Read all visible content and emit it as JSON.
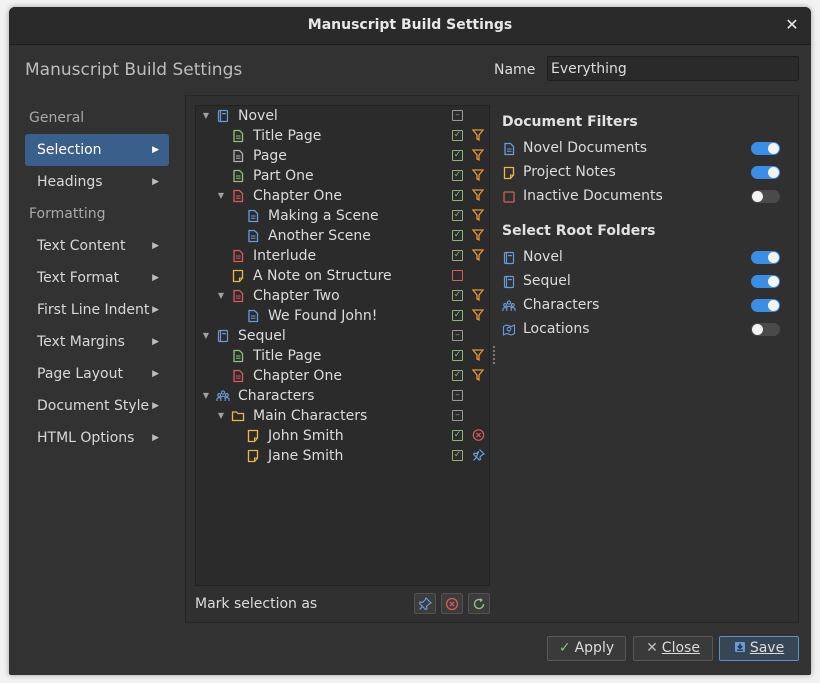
{
  "window": {
    "title": "Manuscript Build Settings"
  },
  "header": {
    "heading": "Manuscript Build Settings",
    "name_label": "Name",
    "name_value": "Everything"
  },
  "nav": {
    "items": [
      {
        "type": "section",
        "label": "General"
      },
      {
        "type": "item",
        "label": "Selection",
        "active": true
      },
      {
        "type": "item",
        "label": "Headings"
      },
      {
        "type": "section",
        "label": "Formatting"
      },
      {
        "type": "item",
        "label": "Text Content"
      },
      {
        "type": "item",
        "label": "Text Format"
      },
      {
        "type": "item",
        "label": "First Line Indent"
      },
      {
        "type": "item",
        "label": "Text Margins"
      },
      {
        "type": "item",
        "label": "Page Layout"
      },
      {
        "type": "item",
        "label": "Document Style"
      },
      {
        "type": "item",
        "label": "HTML Options"
      }
    ]
  },
  "tree": {
    "rows": [
      {
        "label": "Novel",
        "depth": 0,
        "expander": true,
        "icon": "book-icon",
        "check": "mixed",
        "filter": "none"
      },
      {
        "label": "Title Page",
        "depth": 1,
        "expander": false,
        "icon": "doc-green-icon",
        "check": "on",
        "filter": "filter"
      },
      {
        "label": "Page",
        "depth": 1,
        "expander": false,
        "icon": "doc-gray-icon",
        "check": "on",
        "filter": "filter"
      },
      {
        "label": "Part One",
        "depth": 1,
        "expander": false,
        "icon": "doc-green-icon",
        "check": "on",
        "filter": "filter"
      },
      {
        "label": "Chapter One",
        "depth": 1,
        "expander": true,
        "icon": "doc-red-icon",
        "check": "on",
        "filter": "filter"
      },
      {
        "label": "Making a Scene",
        "depth": 2,
        "expander": false,
        "icon": "doc-blue-icon",
        "check": "on",
        "filter": "filter"
      },
      {
        "label": "Another Scene",
        "depth": 2,
        "expander": false,
        "icon": "doc-blue-icon",
        "check": "on",
        "filter": "filter"
      },
      {
        "label": "Interlude",
        "depth": 1,
        "expander": false,
        "icon": "doc-red-icon",
        "check": "on",
        "filter": "filter"
      },
      {
        "label": "A Note on Structure",
        "depth": 1,
        "expander": false,
        "icon": "note-icon",
        "check": "off",
        "filter": "none"
      },
      {
        "label": "Chapter Two",
        "depth": 1,
        "expander": true,
        "icon": "doc-red-icon",
        "check": "on",
        "filter": "filter"
      },
      {
        "label": "We Found John!",
        "depth": 2,
        "expander": false,
        "icon": "doc-blue-icon",
        "check": "on",
        "filter": "filter"
      },
      {
        "label": "Sequel",
        "depth": 0,
        "expander": true,
        "icon": "book-icon",
        "check": "mixed",
        "filter": "none"
      },
      {
        "label": "Title Page",
        "depth": 1,
        "expander": false,
        "icon": "doc-green-icon",
        "check": "on",
        "filter": "filter"
      },
      {
        "label": "Chapter One",
        "depth": 1,
        "expander": false,
        "icon": "doc-red-icon",
        "check": "on",
        "filter": "filter"
      },
      {
        "label": "Characters",
        "depth": 0,
        "expander": true,
        "icon": "people-icon",
        "check": "mixed",
        "filter": "none"
      },
      {
        "label": "Main Characters",
        "depth": 1,
        "expander": true,
        "icon": "folder-icon",
        "check": "mixed",
        "filter": "none"
      },
      {
        "label": "John Smith",
        "depth": 2,
        "expander": false,
        "icon": "note-icon",
        "check": "on",
        "filter": "excluded"
      },
      {
        "label": "Jane Smith",
        "depth": 2,
        "expander": false,
        "icon": "note-icon",
        "check": "on",
        "filter": "pinned"
      }
    ]
  },
  "mark": {
    "label": "Mark selection as"
  },
  "filters": {
    "doc_heading": "Document Filters",
    "doc_items": [
      {
        "label": "Novel Documents",
        "icon": "doc-blue-icon",
        "on": true
      },
      {
        "label": "Project Notes",
        "icon": "note-icon",
        "on": true
      },
      {
        "label": "Inactive Documents",
        "icon": "inactive-icon",
        "on": false
      }
    ],
    "root_heading": "Select Root Folders",
    "root_items": [
      {
        "label": "Novel",
        "icon": "book-icon",
        "on": true
      },
      {
        "label": "Sequel",
        "icon": "book-icon",
        "on": true
      },
      {
        "label": "Characters",
        "icon": "people-icon",
        "on": true
      },
      {
        "label": "Locations",
        "icon": "location-icon",
        "on": false
      }
    ]
  },
  "buttons": {
    "apply": "Apply",
    "close": "Close",
    "save": "Save"
  },
  "colors": {
    "accent": "#3a8ee6",
    "selection": "#3a5f8a",
    "check": "#8fb37a",
    "filter": "#e8963a",
    "excluded": "#d65c5c",
    "doc_blue": "#6a9bd8",
    "doc_green": "#8fc07a",
    "doc_red": "#d65c5c",
    "note_yellow": "#e8b84a"
  }
}
